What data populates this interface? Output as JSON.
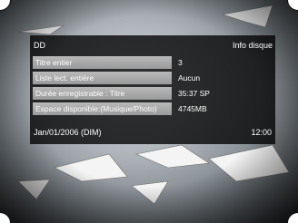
{
  "panel": {
    "disc_label": "DD",
    "title": "Info disque",
    "rows": [
      {
        "label": "Titre entier",
        "value": "3"
      },
      {
        "label": "Liste lect. entière",
        "value": "Aucun"
      },
      {
        "label": "Durée enregistrable : Titre",
        "value": "35:37 SP"
      },
      {
        "label": "Espace disponible:(Musique/Photo)",
        "value": "4745MB"
      }
    ],
    "date": "Jan/01/2006 (DIM)",
    "time": "12:00"
  },
  "icons": {
    "background": "seagulls-sky-image"
  }
}
